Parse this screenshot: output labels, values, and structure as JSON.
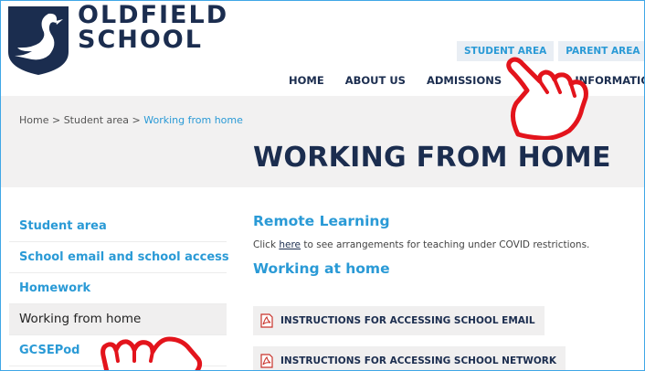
{
  "school": {
    "line1": "OLDFIELD",
    "line2": "SCHOOL"
  },
  "top_tabs": [
    "STUDENT AREA",
    "PARENT AREA"
  ],
  "nav": [
    "HOME",
    "ABOUT US",
    "ADMISSIONS",
    "SCHOOL INFORMATION"
  ],
  "breadcrumb": {
    "home": "Home",
    "sep": ">",
    "section": "Student area",
    "current": "Working from home"
  },
  "page_title": "WORKING FROM HOME",
  "sidebar": [
    {
      "label": "Student area"
    },
    {
      "label": "School email and school access"
    },
    {
      "label": "Homework"
    },
    {
      "label": "Working from home"
    },
    {
      "label": "GCSEPod"
    }
  ],
  "content": {
    "heading_remote": "Remote Learning",
    "para_pre": "Click ",
    "para_link": "here",
    "para_post": " to see arrangements for teaching under COVID restrictions.",
    "heading_home": "Working at home",
    "documents": [
      "INSTRUCTIONS FOR ACCESSING SCHOOL EMAIL",
      "INSTRUCTIONS FOR ACCESSING SCHOOL NETWORK"
    ]
  },
  "colors": {
    "navy": "#1b2d4f",
    "accent": "#2a9ad6",
    "pointer": "#e3141c"
  },
  "icons": [
    "swan-shield-logo",
    "pdf-icon",
    "pointing-hand-icon"
  ]
}
